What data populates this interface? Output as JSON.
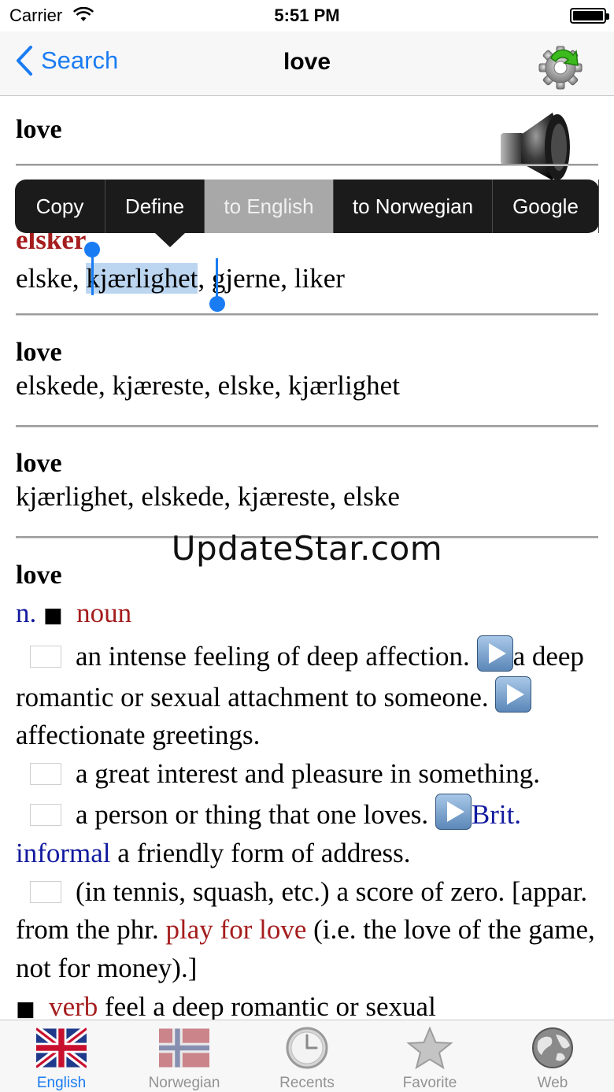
{
  "status_bar": {
    "carrier": "Carrier",
    "time": "5:51 PM"
  },
  "nav": {
    "back_label": "Search",
    "title": "love"
  },
  "entries": [
    {
      "headword": "love",
      "translation": "elsker",
      "line": [
        "elske, ",
        "kjærlighet",
        ", gjerne, liker"
      ]
    },
    {
      "headword": "love",
      "translation": "elskede, kjæreste, elske, kjærlighet"
    },
    {
      "headword": "love",
      "translation": "kjærlighet, elskede, kjæreste, elske"
    },
    {
      "headword": "love"
    }
  ],
  "definition": {
    "pos_abbr": "n.",
    "pos": "noun",
    "sense1": "an intense feeling of deep affection.",
    "sense1b_a": "a",
    "sense1b_rest": "deep romantic or sexual attachment to someone.",
    "sense1c": "affectionate greetings.",
    "sense2": "a great interest and pleasure in something.",
    "sense3": "a person or thing that one loves.",
    "sense3_label": "Brit. informal",
    "sense3b": "a friendly form of address.",
    "sense4": "(in tennis, squash, etc.) a score of zero.",
    "etym_pre": "[appar. from the phr.",
    "etym_phrase": "play for love",
    "etym_post": "(i.e. the love of the game, not for money).]",
    "verb_label": "verb",
    "verb_def": "feel a deep romantic or sexual"
  },
  "callout_menu": {
    "items": [
      "Copy",
      "Define",
      "to English",
      "to Norwegian",
      "Google"
    ],
    "active_index": 2
  },
  "watermark": "UpdateStar.com",
  "tabs": [
    {
      "label": "English",
      "icon": "uk-flag-icon",
      "active": true
    },
    {
      "label": "Norwegian",
      "icon": "norway-flag-icon",
      "active": false
    },
    {
      "label": "Recents",
      "icon": "clock-icon",
      "active": false
    },
    {
      "label": "Favorite",
      "icon": "star-icon",
      "active": false
    },
    {
      "label": "Web",
      "icon": "globe-icon",
      "active": false
    }
  ],
  "colors": {
    "accent": "#1a7cf2",
    "headword_red": "#a51d1d",
    "label_blue": "#121a9e",
    "selection": "#bcd6f1"
  }
}
